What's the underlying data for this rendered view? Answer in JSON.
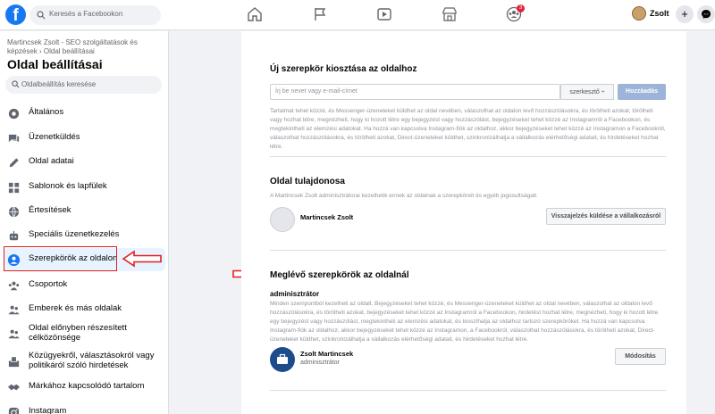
{
  "topbar": {
    "search_placeholder": "Keresés a Facebookon",
    "notification_count": "3",
    "profile_name": "Zsolt",
    "plus_label": "+"
  },
  "sidebar": {
    "breadcrumb": "Martincsek Zsolt - SEO szolgáltatások és képzések › Oldal beállításai",
    "title": "Oldal beállításai",
    "search_placeholder": "Oldalbeállítás keresése",
    "items": [
      {
        "label": "Általános",
        "icon": "gear-icon"
      },
      {
        "label": "Üzenetküldés",
        "icon": "chat-icon"
      },
      {
        "label": "Oldal adatai",
        "icon": "pencil-icon"
      },
      {
        "label": "Sablonok és lapfülek",
        "icon": "grid-icon"
      },
      {
        "label": "Értesítések",
        "icon": "globe-icon"
      },
      {
        "label": "Speciális üzenetkezelés",
        "icon": "robot-icon"
      },
      {
        "label": "Szerepkörök az oldalon",
        "icon": "person-icon"
      },
      {
        "label": "Csoportok",
        "icon": "group-icon"
      },
      {
        "label": "Emberek és más oldalak",
        "icon": "people-icon"
      },
      {
        "label": "Oldal előnyben részesített célközönsége",
        "icon": "people-icon"
      },
      {
        "label": "Közügyekről, választásokról vagy politikáról szóló hirdetések",
        "icon": "ballot-icon"
      },
      {
        "label": "Márkához kapcsolódó tartalom",
        "icon": "handshake-icon"
      },
      {
        "label": "Instagram",
        "icon": "instagram-icon"
      }
    ]
  },
  "main": {
    "assign_title": "Új szerepkör kiosztása az oldalhoz",
    "assign_placeholder": "Írj be nevet vagy e-mail-címet",
    "role_select": "szerkesztő ÷",
    "add_button": "Hozzáadás",
    "assign_desc": "Tartalmat tehet közzé, és Messenger-üzeneteket küldhet az oldal nevében, válaszolhat az oldalon levő hozzászólásokra, és törölheti azokat, törölheti vagy hozhat létre, megnézheti, hogy ki hozott létre egy bejegyzést vagy hozzászólást, bejegyzéseket tehet közzé az Instagramról a Facebookon, és megtekintheti az elemzési adatokat. Ha hozzá van kapcsolva Instagram-fiók az oldalhoz, akkor bejegyzéseket tehet közzé az Instagramon a Facebookról, válaszolhat hozzászólásokra, és törölheti azokat, Direct-üzeneteket küldhet, szinkronizálhatja a vállalkozás elérhetőségi adatait, és hirdetéseket hozhat létre.",
    "owner_title": "Oldal tulajdonosa",
    "owner_desc": "A Martincsek Zsolt adminisztrátorai kezelhetik ennek az oldalnak a szerepköreit és egyéb jogosultságait.",
    "owner_name": "Martincsek Zsolt",
    "owner_button": "Visszajelzés küldése a vállalkozásról",
    "existing_title": "Meglévő szerepkörök az oldalnál",
    "admin_label": "adminisztrátor",
    "admin_desc": "Minden szempontból kezelheti az oldalt. Bejegyzéseket tehet közzé, és Messenger-üzeneteket küldhet az oldal nevében, válaszolhat az oldalon levő hozzászólásokra, és törölheti azokat, bejegyzéseket tehet közzé az Instagramról a Facebookon, hirdetést hozhat létre, megnézheti, hogy ki hozott létre egy bejegyzést vagy hozzászólást, megtekintheti az elemzési adatokat, és kioszthatja az oldalhoz tartozó szerepköröket. Ha hozzá van kapcsolva Instagram-fiók az oldalhoz, akkor bejegyzéseket tehet közzé az Instagramon, a Facebookról, válaszolhat hozzászólásokra, és törölheti azokat, Direct-üzeneteket küldhet, szinkronizálhatja a vállalkozás elérhetőségi adatait, és hirdetéseket hozhat létre.",
    "admin_name": "Zsolt Martincsek",
    "admin_role": "adminisztrátor",
    "edit_button": "Módosítás"
  },
  "colors": {
    "brand": "#1877f2",
    "highlight": "#e41e1e"
  }
}
